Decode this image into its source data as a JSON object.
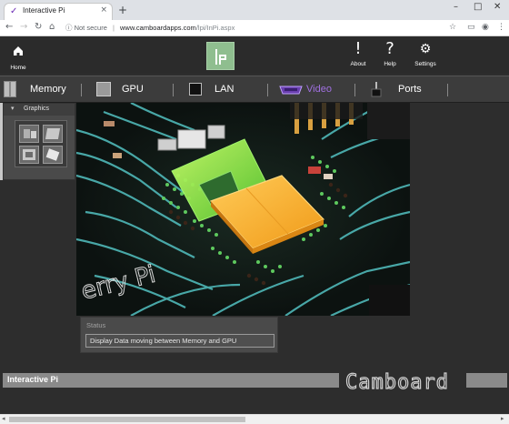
{
  "browser": {
    "tab_title": "Interactive Pi",
    "tab_close": "×",
    "new_tab": "+",
    "window_controls": [
      "–",
      "□",
      "✕"
    ],
    "security_label": "Not secure",
    "url_host": "www.camboardapps.com",
    "url_path": "/lpi/InPi.aspx"
  },
  "header": {
    "home_label": "Home",
    "about_label": "About",
    "help_label": "Help",
    "settings_label": "Settings"
  },
  "nav": {
    "items": [
      {
        "label": "Memory",
        "color": "#ffffff"
      },
      {
        "label": "GPU",
        "color": "#ffffff"
      },
      {
        "label": "LAN",
        "color": "#ffffff"
      },
      {
        "label": "Video",
        "color": "#a070e0"
      },
      {
        "label": "Ports",
        "color": "#ffffff"
      }
    ]
  },
  "side_panel": {
    "title": "Graphics"
  },
  "status": {
    "title": "Status",
    "message": "Display Data moving between Memory and GPU"
  },
  "footer": {
    "title": "Interactive Pi",
    "brand": "Camboard"
  },
  "colors": {
    "accent_video": "#a070e0",
    "logo_green": "#8fbe8f",
    "chip_orange": "#f0a020",
    "chip_green": "#7be34a",
    "trace_teal": "#5fc8c8"
  }
}
